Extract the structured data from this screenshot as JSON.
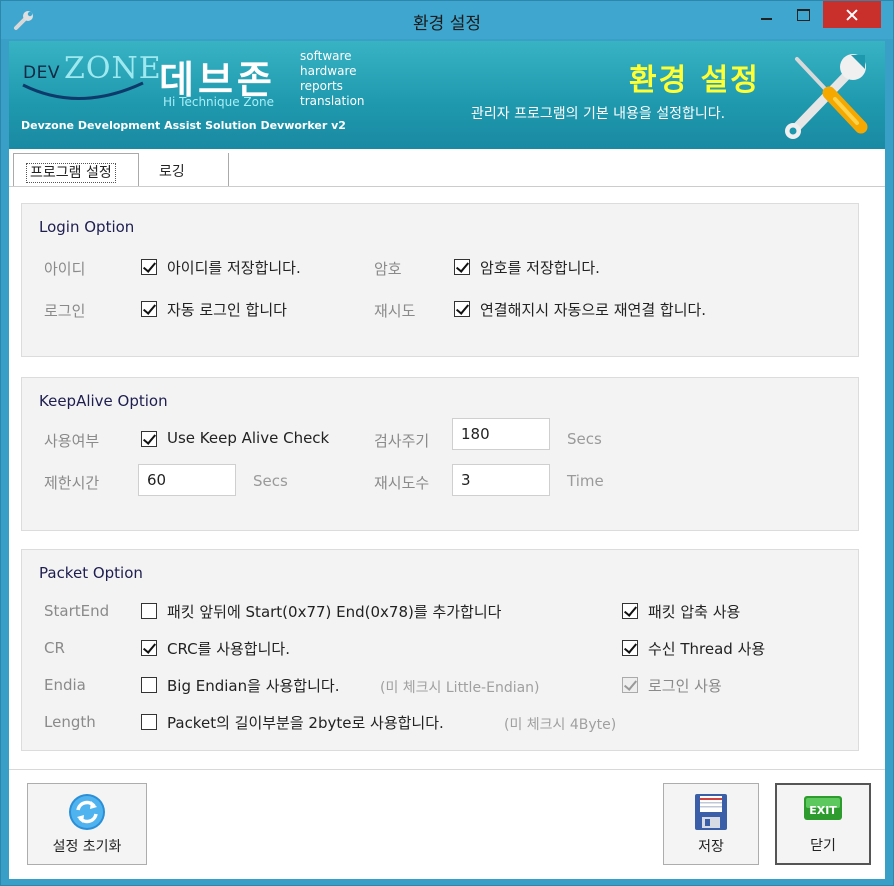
{
  "window": {
    "title": "환경 설정"
  },
  "banner": {
    "logo_dev": "DEV",
    "logo_zone": "ZONE",
    "brand_ko": "데브존",
    "brand_sub": "Hi Technique Zone",
    "brand_words": [
      "software",
      "hardware",
      "reports",
      "translation"
    ],
    "brand_foot": "Devzone Development Assist Solution Devworker v2",
    "title": "환경 설정",
    "description": "관리자 프로그램의 기본 내용을 설정합니다."
  },
  "tabs": [
    {
      "label": "프로그램 설정",
      "active": true
    },
    {
      "label": "로깅",
      "active": false
    }
  ],
  "login_option": {
    "title": "Login Option",
    "id_label": "아이디",
    "id_check": {
      "label": "아이디를 저장합니다.",
      "checked": true
    },
    "pw_label": "암호",
    "pw_check": {
      "label": "암호를 저장합니다.",
      "checked": true
    },
    "autologin_label": "로그인",
    "autologin_check": {
      "label": "자동 로그인 합니다",
      "checked": true
    },
    "retry_label": "재시도",
    "retry_check": {
      "label": "연결해지시 자동으로 재연결 합니다.",
      "checked": true
    }
  },
  "keepalive_option": {
    "title": "KeepAlive Option",
    "use_label": "사용여부",
    "use_check": {
      "label": "Use Keep Alive Check",
      "checked": true
    },
    "interval_label": "검사주기",
    "interval_value": "180",
    "interval_unit": "Secs",
    "limit_label": "제한시간",
    "limit_value": "60",
    "limit_unit": "Secs",
    "retry_count_label": "재시도수",
    "retry_count_value": "3",
    "retry_count_unit": "Time"
  },
  "packet_option": {
    "title": "Packet Option",
    "startend_label": "StartEnd",
    "startend_check": {
      "label": "패킷 앞뒤에 Start(0x77) End(0x78)를 추가합니다",
      "checked": false
    },
    "compress_check": {
      "label": "패킷 압축 사용",
      "checked": true
    },
    "cr_label": "CR",
    "crc_check": {
      "label": "CRC를 사용합니다.",
      "checked": true
    },
    "thread_check": {
      "label": "수신 Thread 사용",
      "checked": true
    },
    "endian_label": "Endia",
    "endian_check": {
      "label": "Big Endian을 사용합니다.",
      "checked": false
    },
    "endian_hint": "(미 체크시 Little-Endian)",
    "login_use_check": {
      "label": "로그인 사용",
      "checked": true,
      "disabled": true
    },
    "length_label": "Length",
    "length_check": {
      "label": "Packet의 길이부분을 2byte로 사용합니다.",
      "checked": false
    },
    "length_hint": "(미 체크시 4Byte)"
  },
  "buttons": {
    "reset": "설정 초기화",
    "save": "저장",
    "close": "닫기",
    "exit_icon_text": "EXIT"
  },
  "colors": {
    "titlebar": "#3fa6cf",
    "banner": "#1e98ad",
    "close_button": "#c9302c",
    "banner_title": "#ffff33"
  }
}
